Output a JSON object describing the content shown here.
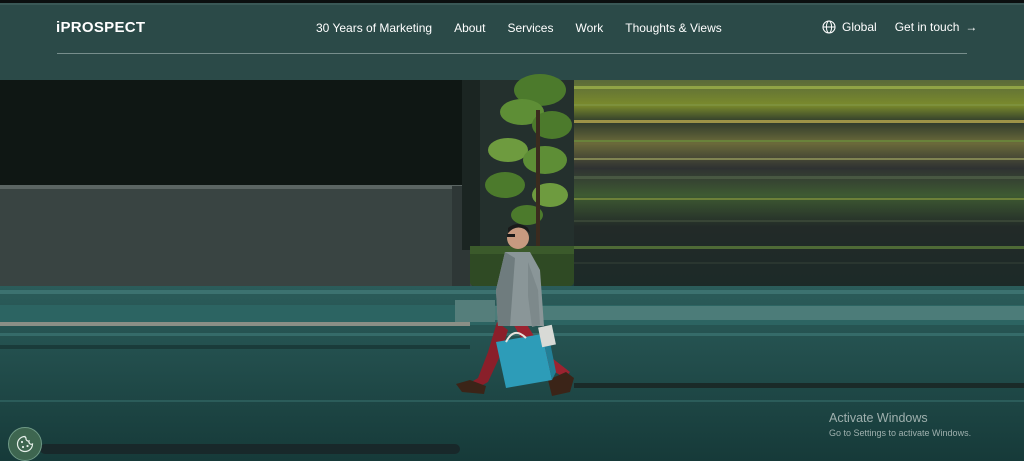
{
  "header": {
    "logo": "iPROSPECT",
    "nav": [
      {
        "label": "30 Years of Marketing"
      },
      {
        "label": "About"
      },
      {
        "label": "Services"
      },
      {
        "label": "Work"
      },
      {
        "label": "Thoughts & Views"
      }
    ],
    "global_label": "Global",
    "cta_label": "Get in touch",
    "cta_icon": "arrow-right-icon",
    "global_icon": "globe-icon"
  },
  "hero": {
    "scene": "street-scene-man-walking-with-shopping-bag"
  },
  "os_watermark": {
    "title": "Activate Windows",
    "subtitle": "Go to Settings to activate Windows."
  },
  "cookie_button": {
    "icon": "cookie-icon"
  },
  "colors": {
    "teal": "#1f4645",
    "dark": "#0e1614",
    "accent_green": "#6e9b3f"
  }
}
